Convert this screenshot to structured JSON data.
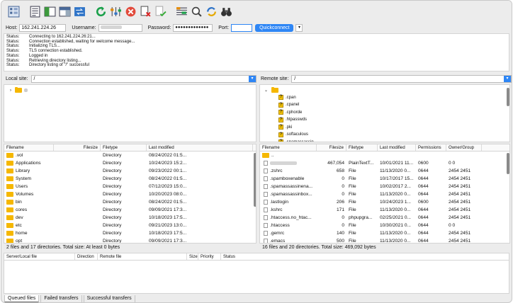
{
  "quickconnect": {
    "host_label": "Host:",
    "host_value": "162.241.224.26",
    "user_label": "Username:",
    "pass_label": "Password:",
    "pass_value": "●●●●●●●●●●●●●",
    "port_label": "Port:",
    "port_value": "",
    "button": "Quickconnect"
  },
  "log": [
    {
      "k": "Status:",
      "v": "Connecting to 162.241.224.26:21..."
    },
    {
      "k": "Status:",
      "v": "Connection established, waiting for welcome message..."
    },
    {
      "k": "Status:",
      "v": "Initializing TLS..."
    },
    {
      "k": "Status:",
      "v": "TLS connection established."
    },
    {
      "k": "Status:",
      "v": "Logged in"
    },
    {
      "k": "Status:",
      "v": "Retrieving directory listing..."
    },
    {
      "k": "Status:",
      "v": "Directory listing of \"/\" successful"
    }
  ],
  "local": {
    "label": "Local site:",
    "path": "/",
    "status": "2 files and 17 directories. Total size: At least 0 bytes",
    "columns": [
      "Filename",
      "Filesize",
      "Filetype",
      "Last modified"
    ],
    "rows": [
      {
        "name": ".vol",
        "size": "",
        "type": "Directory",
        "mod": "08/24/2022 01:5..."
      },
      {
        "name": "Applications",
        "size": "",
        "type": "Directory",
        "mod": "10/24/2023 15:2..."
      },
      {
        "name": "Library",
        "size": "",
        "type": "Directory",
        "mod": "09/23/2022 00:1..."
      },
      {
        "name": "System",
        "size": "",
        "type": "Directory",
        "mod": "08/24/2022 01:5..."
      },
      {
        "name": "Users",
        "size": "",
        "type": "Directory",
        "mod": "07/12/2023 15:0..."
      },
      {
        "name": "Volumes",
        "size": "",
        "type": "Directory",
        "mod": "10/20/2023 08:0..."
      },
      {
        "name": "bin",
        "size": "",
        "type": "Directory",
        "mod": "08/24/2022 01:5..."
      },
      {
        "name": "cores",
        "size": "",
        "type": "Directory",
        "mod": "09/09/2021 17:3..."
      },
      {
        "name": "dev",
        "size": "",
        "type": "Directory",
        "mod": "10/18/2023 17:5..."
      },
      {
        "name": "etc",
        "size": "",
        "type": "Directory",
        "mod": "09/21/2023 13:0..."
      },
      {
        "name": "home",
        "size": "",
        "type": "Directory",
        "mod": "10/18/2023 17:5..."
      },
      {
        "name": "opt",
        "size": "",
        "type": "Directory",
        "mod": "09/09/2021 17:3..."
      }
    ]
  },
  "remote": {
    "label": "Remote site:",
    "path": "/",
    "status": "16 files and 20 directories. Total size: 469,092 bytes",
    "tree": [
      ".cpan",
      ".cpanel",
      ".cphorde",
      ".htpasswds",
      ".pki",
      ".softaculous",
      ".spamassassin"
    ],
    "columns": [
      "Filename",
      "Filesize",
      "Filetype",
      "Last modified",
      "Permissions",
      "Owner/Group"
    ],
    "rows": [
      {
        "name": "..",
        "size": "",
        "type": "",
        "mod": "",
        "perm": "",
        "own": "",
        "kind": "folder"
      },
      {
        "name": "",
        "size": "467,054",
        "type": "PlainTextT...",
        "mod": "10/01/2021 11...",
        "perm": "0600",
        "own": "0 0",
        "kind": "blur"
      },
      {
        "name": ".zshrc",
        "size": "658",
        "type": "File",
        "mod": "11/13/2020 0...",
        "perm": "0644",
        "own": "2454 2451",
        "kind": "file"
      },
      {
        "name": ".spamboxenable",
        "size": "0",
        "type": "File",
        "mod": "10/17/2017 15...",
        "perm": "0644",
        "own": "2454 2451",
        "kind": "file"
      },
      {
        "name": ".spamassassinena...",
        "size": "0",
        "type": "File",
        "mod": "10/02/2017 2...",
        "perm": "0644",
        "own": "2454 2451",
        "kind": "file"
      },
      {
        "name": ".spamassassinbox...",
        "size": "0",
        "type": "File",
        "mod": "11/13/2020 0...",
        "perm": "0644",
        "own": "2454 2451",
        "kind": "file"
      },
      {
        "name": ".lastlogin",
        "size": "206",
        "type": "File",
        "mod": "10/24/2023 1...",
        "perm": "0600",
        "own": "2454 2451",
        "kind": "file"
      },
      {
        "name": ".kshrc",
        "size": "171",
        "type": "File",
        "mod": "11/13/2020 0...",
        "perm": "0644",
        "own": "2454 2451",
        "kind": "file"
      },
      {
        "name": ".htaccess.no_htac...",
        "size": "0",
        "type": "phpupgra...",
        "mod": "02/25/2021 0...",
        "perm": "0644",
        "own": "2454 2451",
        "kind": "file"
      },
      {
        "name": ".htaccess",
        "size": "0",
        "type": "File",
        "mod": "10/30/2021 0...",
        "perm": "0644",
        "own": "0 0",
        "kind": "file"
      },
      {
        "name": ".gemrc",
        "size": "140",
        "type": "File",
        "mod": "11/13/2020 0...",
        "perm": "0644",
        "own": "2454 2451",
        "kind": "file"
      },
      {
        "name": ".emacs",
        "size": "500",
        "type": "File",
        "mod": "11/13/2020 0...",
        "perm": "0644",
        "own": "2454 2451",
        "kind": "file"
      }
    ]
  },
  "queue": {
    "columns": [
      "Server/Local file",
      "Direction",
      "Remote file",
      "Size",
      "Priority",
      "Status"
    ]
  },
  "tabs": [
    "Queued files",
    "Failed transfers",
    "Successful transfers"
  ]
}
